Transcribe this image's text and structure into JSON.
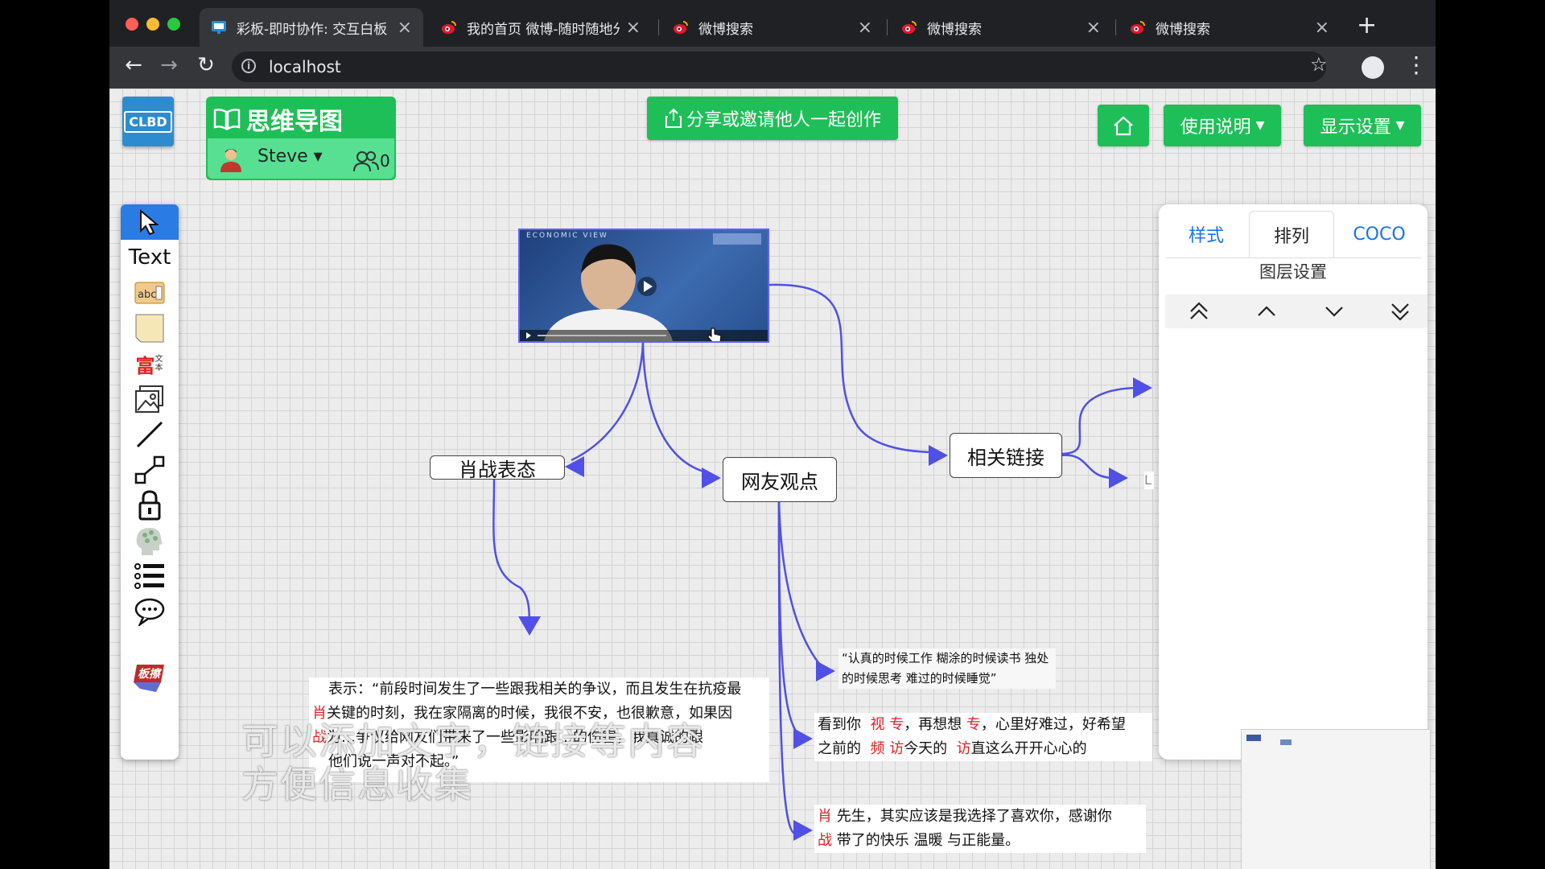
{
  "browser": {
    "tabs": [
      {
        "label": "彩板-即时协作: 交互白板",
        "active": true
      },
      {
        "label": "我的首页 微博-随时随地分享"
      },
      {
        "label": "微博搜索"
      },
      {
        "label": "微博搜索"
      },
      {
        "label": "微博搜索"
      }
    ],
    "url": "localhost"
  },
  "app": {
    "logo": "CLBD",
    "title": "思维导图",
    "user": "Steve",
    "online_count": "0",
    "share_button": "分享或邀请他人一起创作",
    "help_button": "使用说明",
    "display_button": "显示设置"
  },
  "toolbar": {
    "text_tool": "Text",
    "rich_text_label": "富",
    "rich_text_sub": "文本",
    "brand": "板擦"
  },
  "mindmap": {
    "nodes": {
      "left": "肖战表态",
      "middle": "网友观点",
      "right": "相关链接"
    },
    "video_banner": "ECONOMIC VIEW",
    "quote1": "“认真的时候工作 糊涂的时候读书 独处的时候思考 难过的时候睡觉”",
    "statement": {
      "line1": "表示：“前段时间发生了一些跟我相关的争议，而且发生在抗疫最",
      "line2_mark": "肖",
      "line2": "关键的时刻，我在家隔离的时候，我很不安，也很歉意，如果因",
      "line3_mark": "战",
      "line3": "为…争议给网友们带来了一些影响跟…的伤害，我真诚的跟",
      "line4": "他们说一声对不起。”"
    },
    "comment1": {
      "a": "看到你",
      "b": "视",
      "c": "专",
      "d": "，再想想",
      "e": "专",
      "f": "，心里好难过，好希望",
      "g": "之前的",
      "h": "频",
      "i": "访",
      "j": "今天的",
      "k": "访",
      "l": "直这么开开心心的"
    },
    "comment2": {
      "mark1": "肖",
      "line1": "先生，其实应该是我选择了喜欢你，感谢你",
      "mark2": "战",
      "line2": "带了的快乐 温暖 与正能量。"
    },
    "caption_line1": "可以添加文字，链接等内容",
    "caption_line2": "方便信息收集",
    "partial_label": "L"
  },
  "panel": {
    "tabs": [
      "样式",
      "排列",
      "COCO"
    ],
    "active_tab": "排列",
    "section_title": "图层设置"
  },
  "colors": {
    "green": "#1ebf58",
    "blue_accent": "#2b7be4",
    "connector": "#5050e6"
  }
}
